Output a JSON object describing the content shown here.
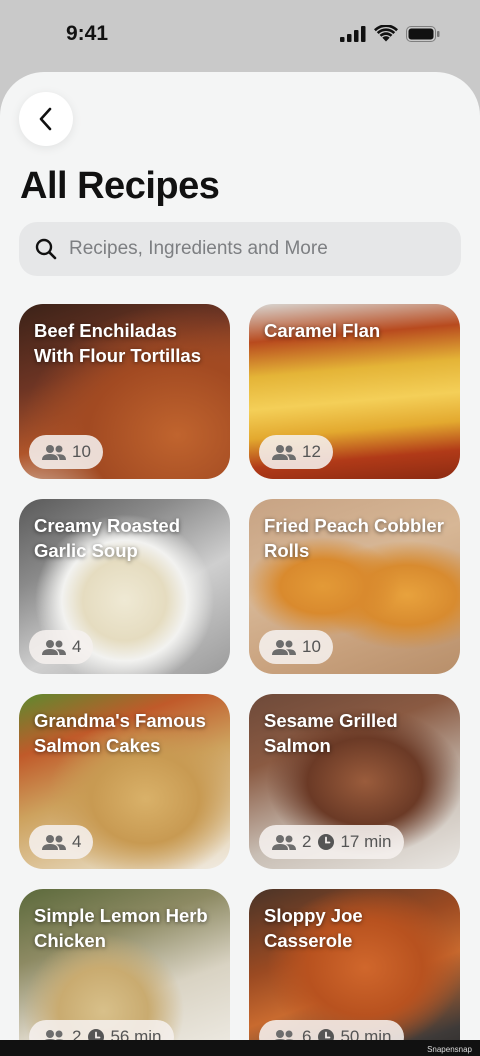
{
  "status": {
    "time": "9:41"
  },
  "header": {
    "title": "All Recipes"
  },
  "search": {
    "placeholder": "Recipes, Ingredients and More"
  },
  "recipes": [
    {
      "title": "Beef Enchiladas With Flour Tortillas",
      "servings": "10",
      "time": ""
    },
    {
      "title": "Caramel Flan",
      "servings": "12",
      "time": ""
    },
    {
      "title": "Creamy Roasted Garlic Soup",
      "servings": "4",
      "time": ""
    },
    {
      "title": "Fried Peach Cobbler Rolls",
      "servings": "10",
      "time": ""
    },
    {
      "title": "Grandma's Famous Salmon Cakes",
      "servings": "4",
      "time": ""
    },
    {
      "title": "Sesame Grilled Salmon",
      "servings": "2",
      "time": "17 min"
    },
    {
      "title": "Simple Lemon Herb Chicken",
      "servings": "2",
      "time": "56 min"
    },
    {
      "title": "Sloppy Joe Casserole",
      "servings": "6",
      "time": "50 min"
    }
  ],
  "footer": {
    "watermark": "Snapensnap"
  },
  "colors": {
    "background": "#f4f5f5",
    "search_bg": "#e6e7e8",
    "chip_bg": "#f5f0ee"
  }
}
